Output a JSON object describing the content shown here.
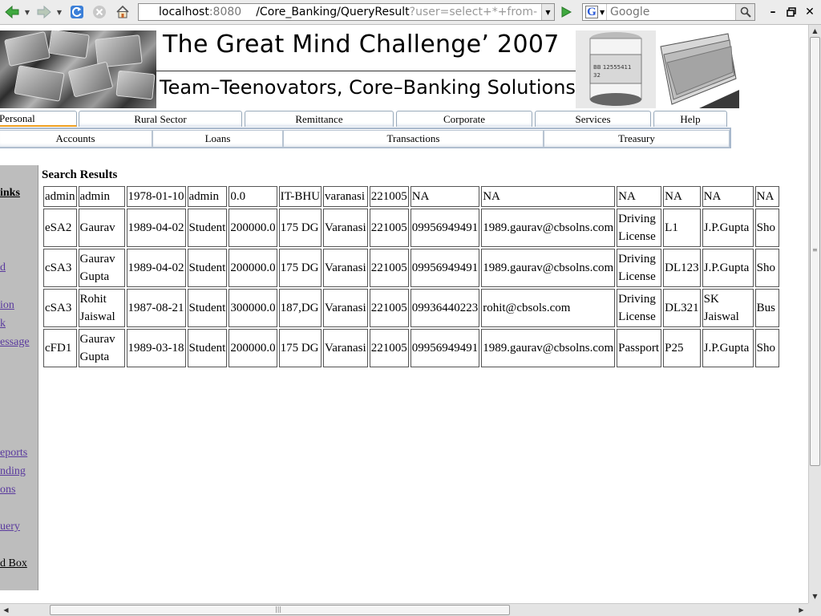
{
  "browser": {
    "url": {
      "host": "localhost",
      "port": ":8080",
      "path": "/Core_Banking/QueryResult",
      "query": "?user=select+*+from- ..."
    },
    "search": {
      "placeholder": "Google",
      "engine_letter": "G"
    },
    "icons": [
      "back-icon",
      "forward-icon",
      "reload-icon",
      "stop-icon",
      "home-icon",
      "go-icon",
      "search-icon",
      "minimize-icon",
      "maximize-icon",
      "close-icon"
    ],
    "accent": "#2a8a2a"
  },
  "banner": {
    "title": "The Great Mind Challenge’ 2007",
    "subtitle": "Team–Teenovators, Core–Banking Solutions"
  },
  "nav": {
    "tabs": [
      {
        "label": "Personal"
      },
      {
        "label": "Rural Sector"
      },
      {
        "label": "Remittance"
      },
      {
        "label": "Corporate"
      },
      {
        "label": "Services"
      },
      {
        "label": "Help"
      }
    ],
    "subtabs": [
      {
        "label": "Accounts"
      },
      {
        "label": "Loans"
      },
      {
        "label": "Transactions"
      },
      {
        "label": "Treasury"
      }
    ],
    "active_tab_color": "#f0a020"
  },
  "sidebar": {
    "heading": "inks",
    "links": [
      {
        "label": "d"
      },
      {
        "label": "ion"
      },
      {
        "label": "k"
      },
      {
        "label": "essage"
      },
      {
        "label": "eports"
      },
      {
        "label": "nding"
      },
      {
        "label": "ons"
      },
      {
        "label": "uery"
      }
    ],
    "bottom_link": "d Box",
    "link_color": "#5a3a9e"
  },
  "results": {
    "title": "Search Results",
    "rows": [
      [
        "admin",
        "admin",
        "1978-01-10",
        "admin",
        "0.0",
        "IT-BHU",
        "varanasi",
        "221005",
        "NA",
        "NA",
        "NA",
        "NA",
        "NA",
        "NA"
      ],
      [
        "eSA2",
        "Gaurav",
        "1989-04-02",
        "Student",
        "200000.0",
        "175 DG",
        "Varanasi",
        "221005",
        "09956949491",
        "1989.gaurav@cbsolns.com",
        "Driving License",
        "L1",
        "J.P.Gupta",
        "Sho"
      ],
      [
        "cSA3",
        "Gaurav Gupta",
        "1989-04-02",
        "Student",
        "200000.0",
        "175 DG",
        "Varanasi",
        "221005",
        "09956949491",
        "1989.gaurav@cbsolns.com",
        "Driving License",
        "DL123",
        "J.P.Gupta",
        "Sho"
      ],
      [
        "cSA3",
        "Rohit Jaiswal",
        "1987-08-21",
        "Student",
        "300000.0",
        "187,DG",
        "Varanasi",
        "221005",
        "09936440223",
        "rohit@cbsols.com",
        "Driving License",
        "DL321",
        "SK Jaiswal",
        "Bus"
      ],
      [
        "cFD1",
        "Gaurav Gupta",
        "1989-03-18",
        "Student",
        "200000.0",
        "175 DG",
        "Varanasi",
        "221005",
        "09956949491",
        "1989.gaurav@cbsolns.com",
        "Passport",
        "P25",
        "J.P.Gupta",
        "Sho"
      ]
    ]
  }
}
